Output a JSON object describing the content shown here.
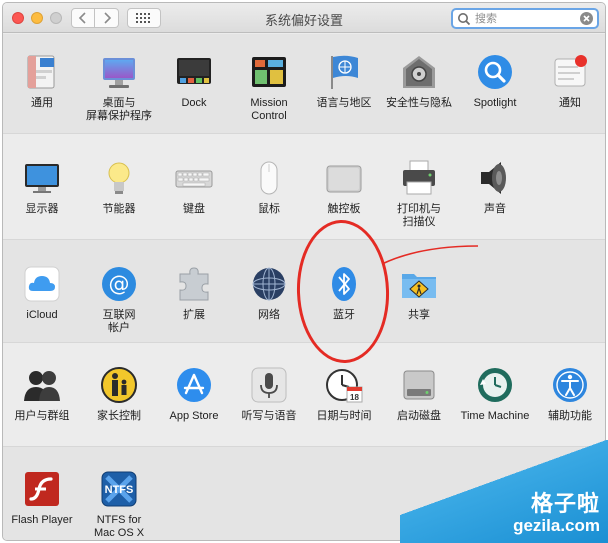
{
  "window": {
    "title": "系统偏好设置"
  },
  "search": {
    "placeholder": "搜索"
  },
  "rows": [
    {
      "items": [
        {
          "label": "通用",
          "icon": "general-icon"
        },
        {
          "label": "桌面与\n屏幕保护程序",
          "icon": "desktop-screensaver-icon"
        },
        {
          "label": "Dock",
          "icon": "dock-icon"
        },
        {
          "label": "Mission\nControl",
          "icon": "mission-control-icon"
        },
        {
          "label": "语言与地区",
          "icon": "language-region-icon"
        },
        {
          "label": "安全性与隐私",
          "icon": "security-privacy-icon"
        },
        {
          "label": "Spotlight",
          "icon": "spotlight-icon"
        },
        {
          "label": "通知",
          "icon": "notifications-icon"
        }
      ]
    },
    {
      "items": [
        {
          "label": "显示器",
          "icon": "displays-icon"
        },
        {
          "label": "节能器",
          "icon": "energy-saver-icon"
        },
        {
          "label": "键盘",
          "icon": "keyboard-icon"
        },
        {
          "label": "鼠标",
          "icon": "mouse-icon"
        },
        {
          "label": "触控板",
          "icon": "trackpad-icon"
        },
        {
          "label": "打印机与\n扫描仪",
          "icon": "printer-scanner-icon"
        },
        {
          "label": "声音",
          "icon": "sound-icon"
        }
      ]
    },
    {
      "items": [
        {
          "label": "iCloud",
          "icon": "icloud-icon"
        },
        {
          "label": "互联网\n帐户",
          "icon": "internet-accounts-icon"
        },
        {
          "label": "扩展",
          "icon": "extensions-icon"
        },
        {
          "label": "网络",
          "icon": "network-icon"
        },
        {
          "label": "蓝牙",
          "icon": "bluetooth-icon"
        },
        {
          "label": "共享",
          "icon": "sharing-icon"
        }
      ]
    },
    {
      "items": [
        {
          "label": "用户与群组",
          "icon": "users-groups-icon"
        },
        {
          "label": "家长控制",
          "icon": "parental-controls-icon"
        },
        {
          "label": "App Store",
          "icon": "app-store-icon"
        },
        {
          "label": "听写与语音",
          "icon": "dictation-speech-icon"
        },
        {
          "label": "日期与时间",
          "icon": "date-time-icon"
        },
        {
          "label": "启动磁盘",
          "icon": "startup-disk-icon"
        },
        {
          "label": "Time Machine",
          "icon": "time-machine-icon"
        },
        {
          "label": "辅助功能",
          "icon": "accessibility-icon"
        }
      ]
    },
    {
      "items": [
        {
          "label": "Flash Player",
          "icon": "flash-player-icon"
        },
        {
          "label": "NTFS for\nMac OS X",
          "icon": "ntfs-icon"
        }
      ]
    }
  ],
  "watermark": {
    "cn": "格子啦",
    "en": "gezila.com"
  },
  "colors": {
    "annotation": "#e42b24",
    "search_focus": "#6aa5e6",
    "watermark": "#1a8fd3"
  }
}
